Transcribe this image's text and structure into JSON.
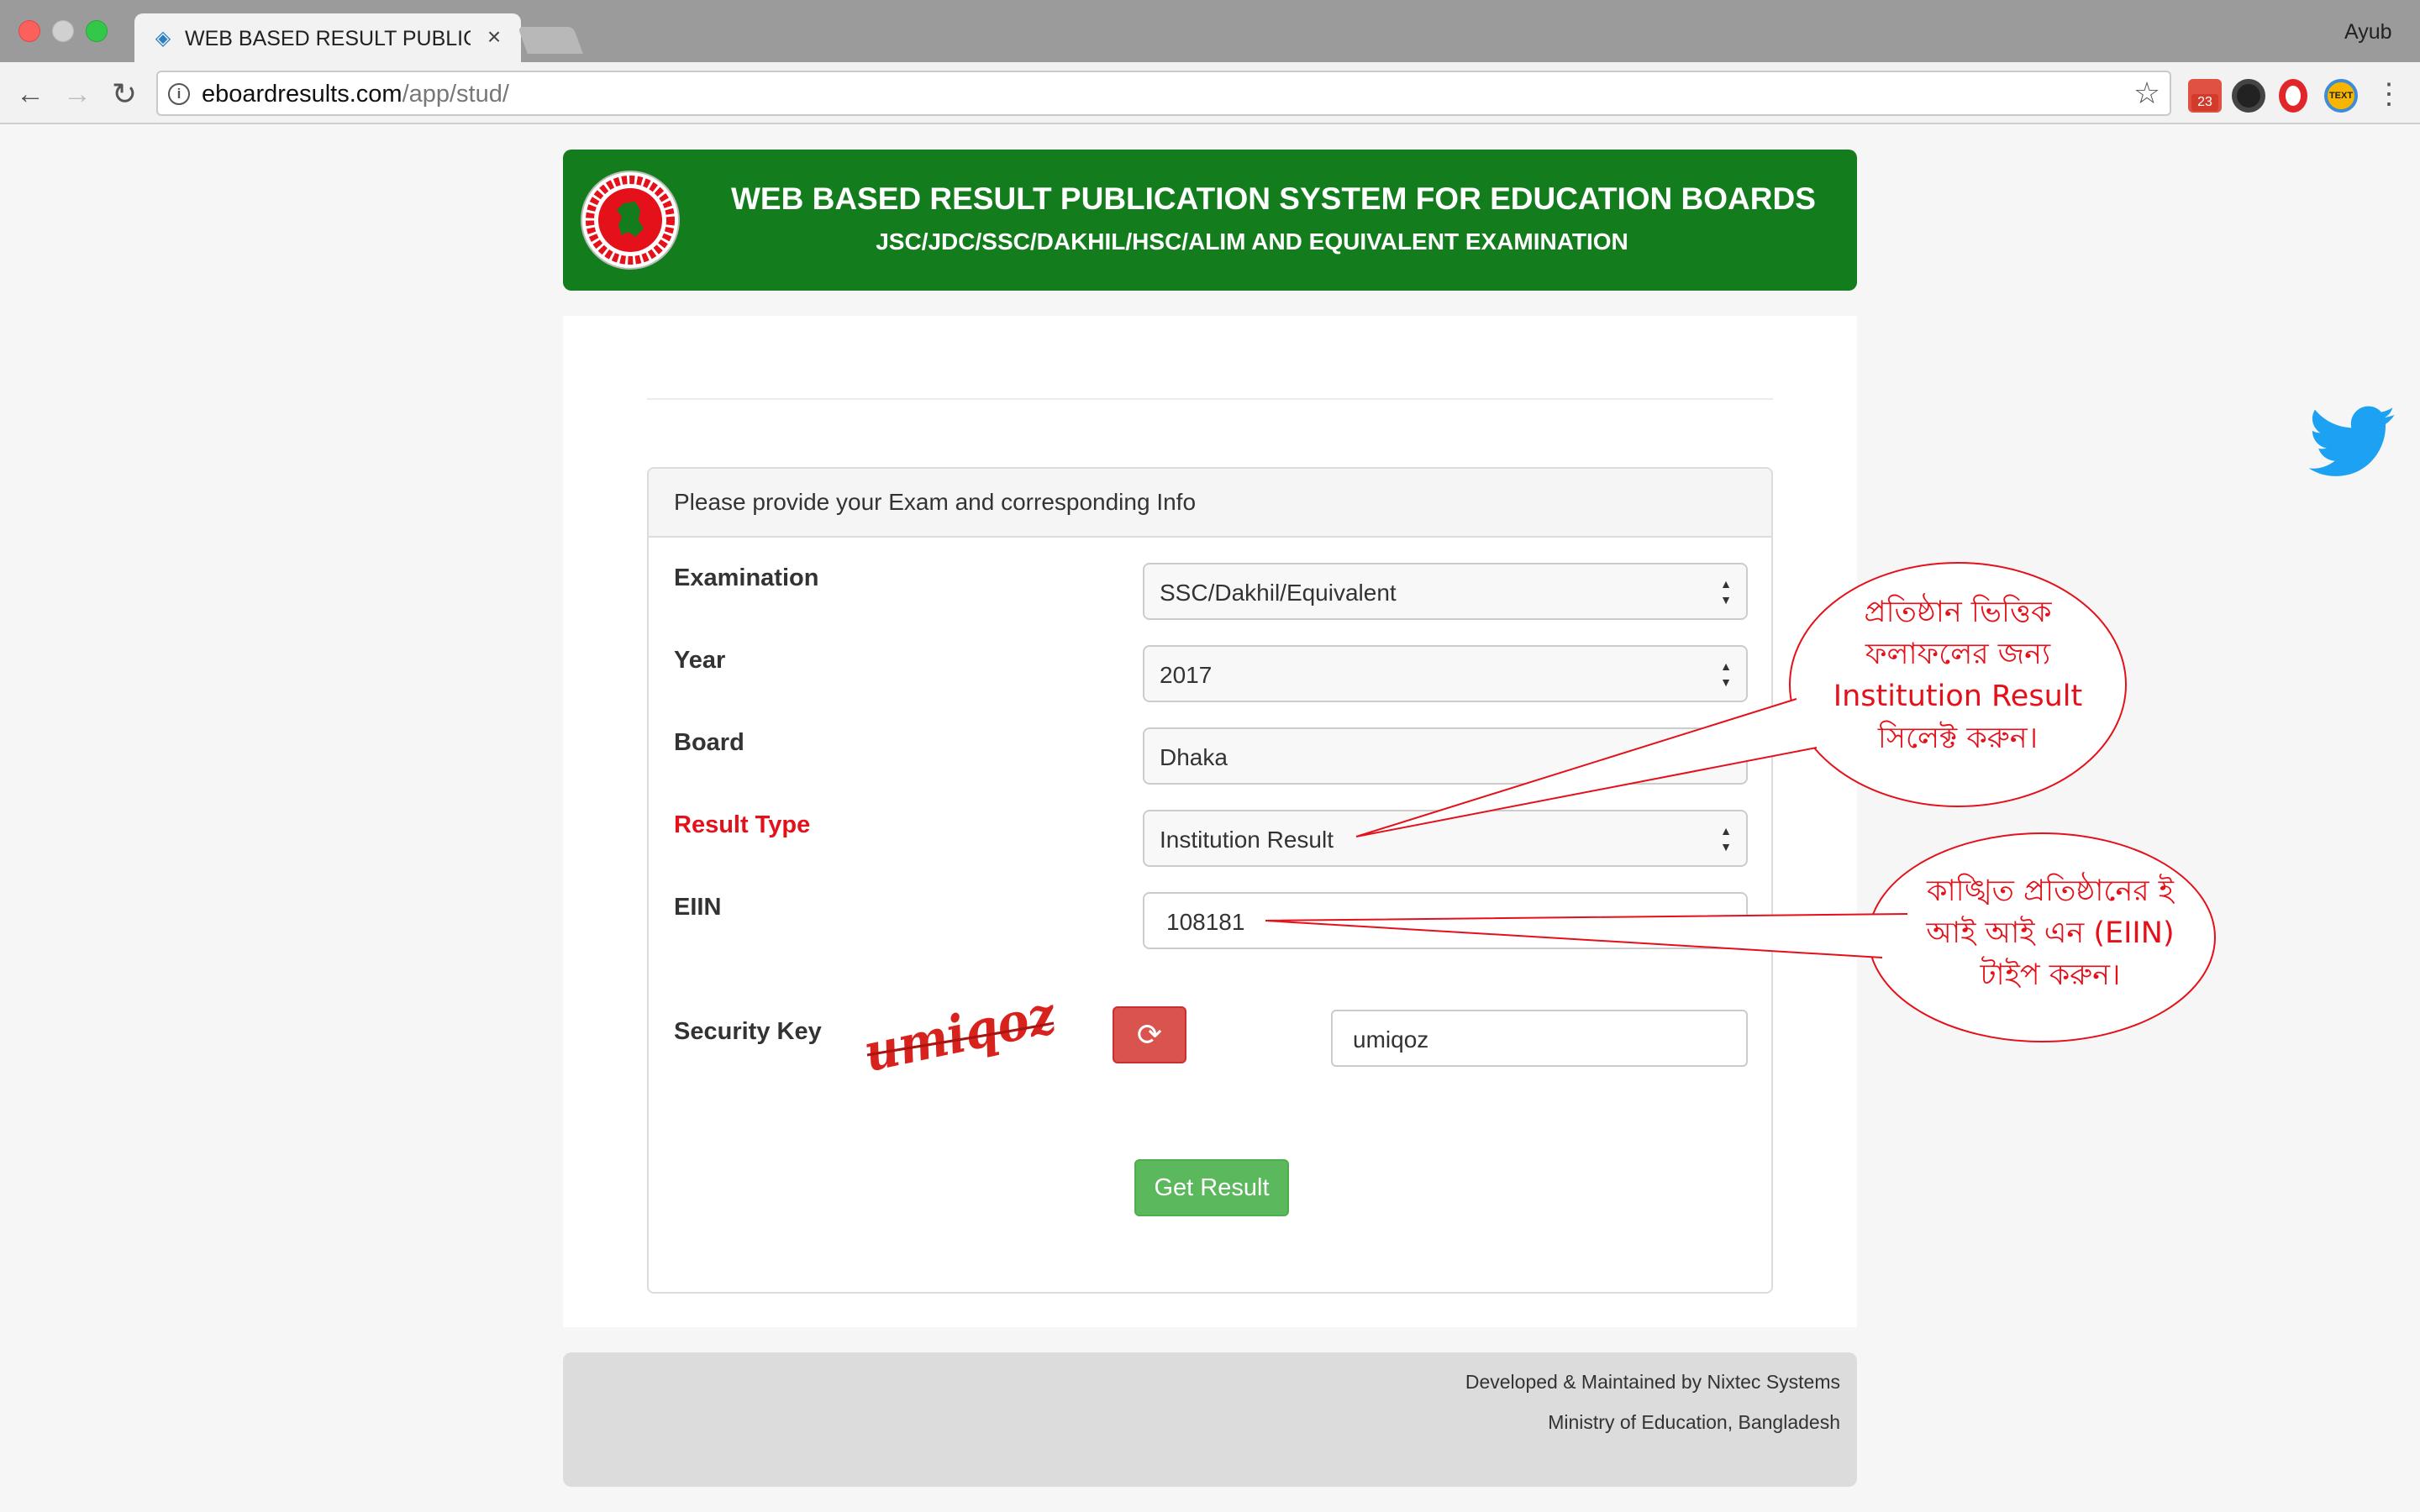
{
  "browser": {
    "tab_title": "WEB BASED RESULT PUBLICA",
    "profile_name": "Ayub",
    "url_host": "eboardresults.com",
    "url_path": "/app/stud/",
    "gmail_badge": "23",
    "text_ext_label": "TEXT"
  },
  "header": {
    "title": "WEB BASED RESULT PUBLICATION SYSTEM FOR EDUCATION BOARDS",
    "subtitle": "JSC/JDC/SSC/DAKHIL/HSC/ALIM AND EQUIVALENT EXAMINATION"
  },
  "form": {
    "heading": "Please provide your Exam and corresponding Info",
    "fields": [
      {
        "label": "Examination",
        "value": "SSC/Dakhil/Equivalent"
      },
      {
        "label": "Year",
        "value": "2017"
      },
      {
        "label": "Board",
        "value": "Dhaka"
      },
      {
        "label": "Result Type",
        "value": "Institution Result"
      },
      {
        "label": "EIIN",
        "value": "108181"
      }
    ],
    "security_key_label": "Security Key",
    "captcha_text": "umiqoz",
    "security_key_value": "umiqoz",
    "submit_label": "Get Result"
  },
  "footer": {
    "line1": "Developed & Maintained by Nixtec Systems",
    "line2": "Ministry of Education, Bangladesh"
  },
  "annotations": [
    {
      "lines": [
        "প্রতিষ্ঠান ভিত্তিক",
        "ফলাফলের জন্য",
        "Institution Result",
        "সিলেক্ট করুন।"
      ]
    },
    {
      "lines": [
        "কাঙ্খিত প্রতিষ্ঠানের ই",
        "আই আই এন (EIIN)",
        "টাইপ করুন।"
      ]
    }
  ],
  "colors": {
    "banner_green": "#137c1c",
    "result_type_label": "#e4101a",
    "submit_green": "#5cb85c",
    "refresh_red": "#d9534f",
    "annotation_red": "#e4101a",
    "twitter_blue": "#1da1f2"
  },
  "icons": [
    "back-icon",
    "forward-icon",
    "reload-icon",
    "info-icon",
    "star-icon",
    "menu-icon",
    "refresh-icon",
    "twitter-icon",
    "seal-logo"
  ]
}
